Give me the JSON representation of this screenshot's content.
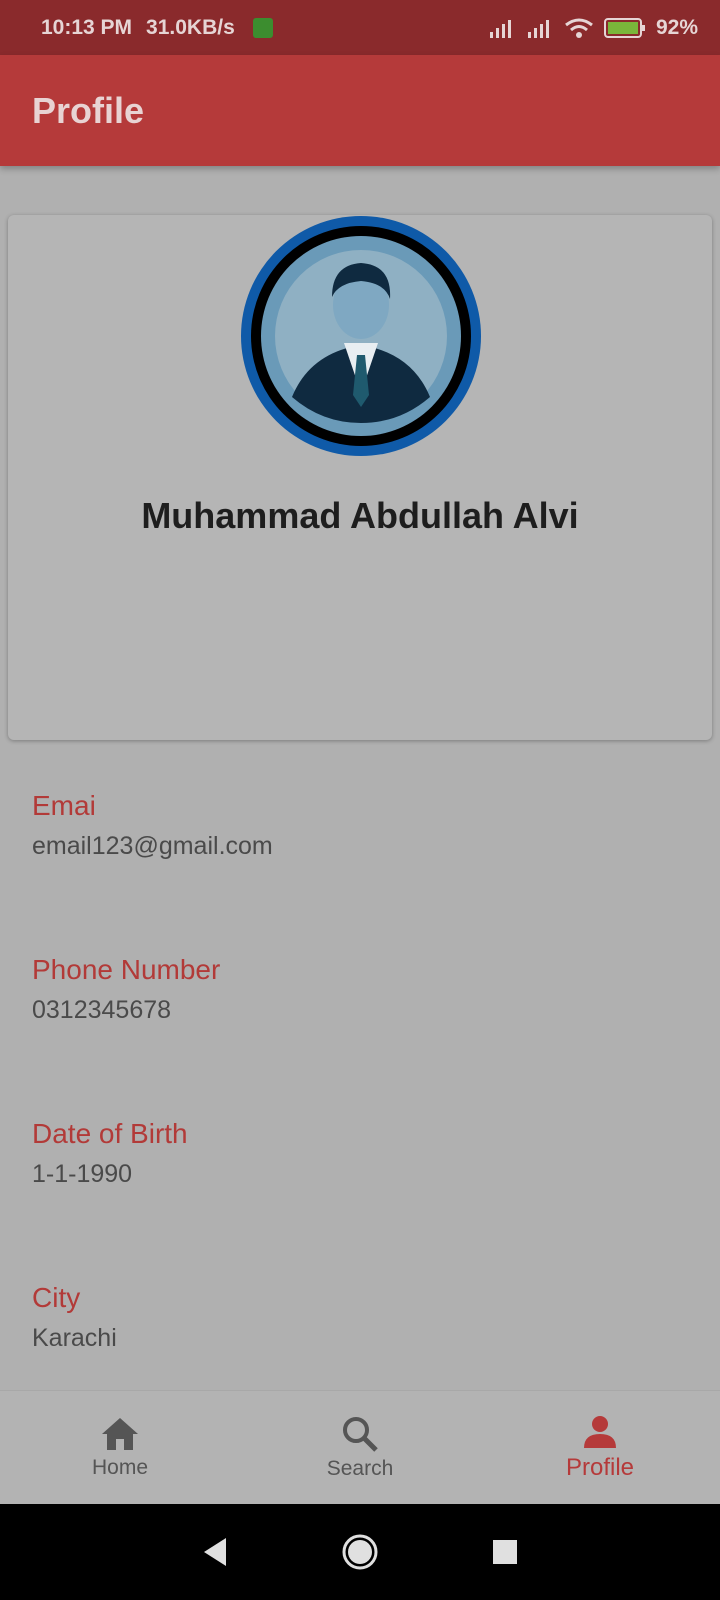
{
  "status_bar": {
    "time": "10:13 PM",
    "network_speed": "31.0KB/s",
    "battery": "92%"
  },
  "app_bar": {
    "title": "Profile"
  },
  "profile": {
    "name": "Muhammad Abdullah Alvi"
  },
  "info": [
    {
      "label": "Emai",
      "value": "email123@gmail.com"
    },
    {
      "label": "Phone Number",
      "value": "0312345678"
    },
    {
      "label": "Date of Birth",
      "value": "1-1-1990"
    },
    {
      "label": "City",
      "value": "Karachi"
    }
  ],
  "bottom_nav": [
    {
      "label": "Home",
      "icon": "home-icon",
      "active": false
    },
    {
      "label": "Search",
      "icon": "search-icon",
      "active": false
    },
    {
      "label": "Profile",
      "icon": "person-icon",
      "active": true
    }
  ],
  "colors": {
    "accent": "#b53a3a",
    "status_bar": "#8a2a2c",
    "background": "#b0b0b0"
  }
}
